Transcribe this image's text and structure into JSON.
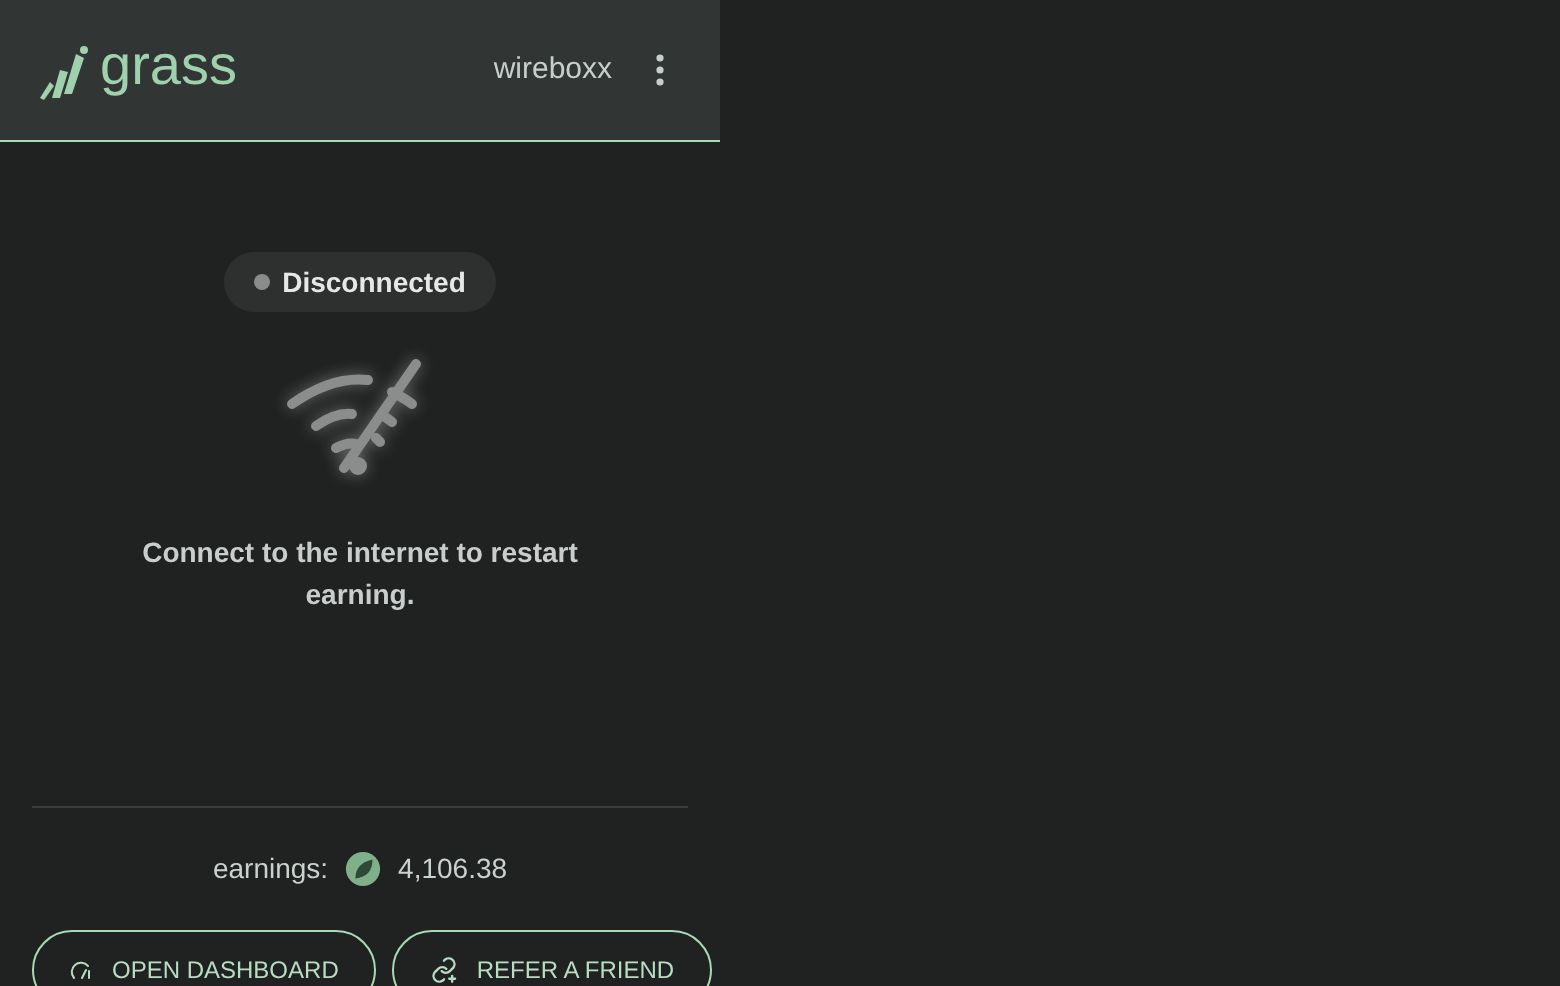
{
  "header": {
    "logo": "grass",
    "username": "wireboxx"
  },
  "status": {
    "label": "Disconnected",
    "connected": false
  },
  "message": "Connect to the internet to restart earning.",
  "earnings": {
    "label": "earnings:",
    "value": "4,106.38"
  },
  "buttons": [
    {
      "kind": "dashboard",
      "label": "OPEN DASHBOARD"
    },
    {
      "kind": "refer",
      "label": "REFER A FRIEND"
    }
  ]
}
